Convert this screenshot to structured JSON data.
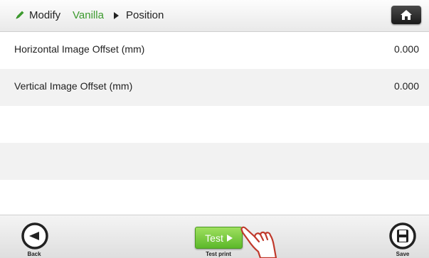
{
  "header": {
    "icon": "pencil-icon",
    "modify_label": "Modify",
    "recipe_name": "Vanilla",
    "separator_icon": "triangle-right-icon",
    "section_label": "Position",
    "home_icon": "home-icon",
    "accent_color": "#3c9a2e"
  },
  "rows": [
    {
      "label": "Horizontal Image Offset (mm)",
      "value": "0.000"
    },
    {
      "label": "Vertical Image Offset (mm)",
      "value": "0.000"
    },
    {
      "label": "",
      "value": ""
    },
    {
      "label": "",
      "value": ""
    },
    {
      "label": "",
      "value": ""
    }
  ],
  "footer": {
    "back_label": "Back",
    "back_icon": "arrow-left-circle-icon",
    "test_button_label": "Test",
    "test_caption": "Test print",
    "test_color": "#6cc43a",
    "save_label": "Save",
    "save_icon": "floppy-disk-icon",
    "cursor_icon": "pointing-hand-icon"
  }
}
